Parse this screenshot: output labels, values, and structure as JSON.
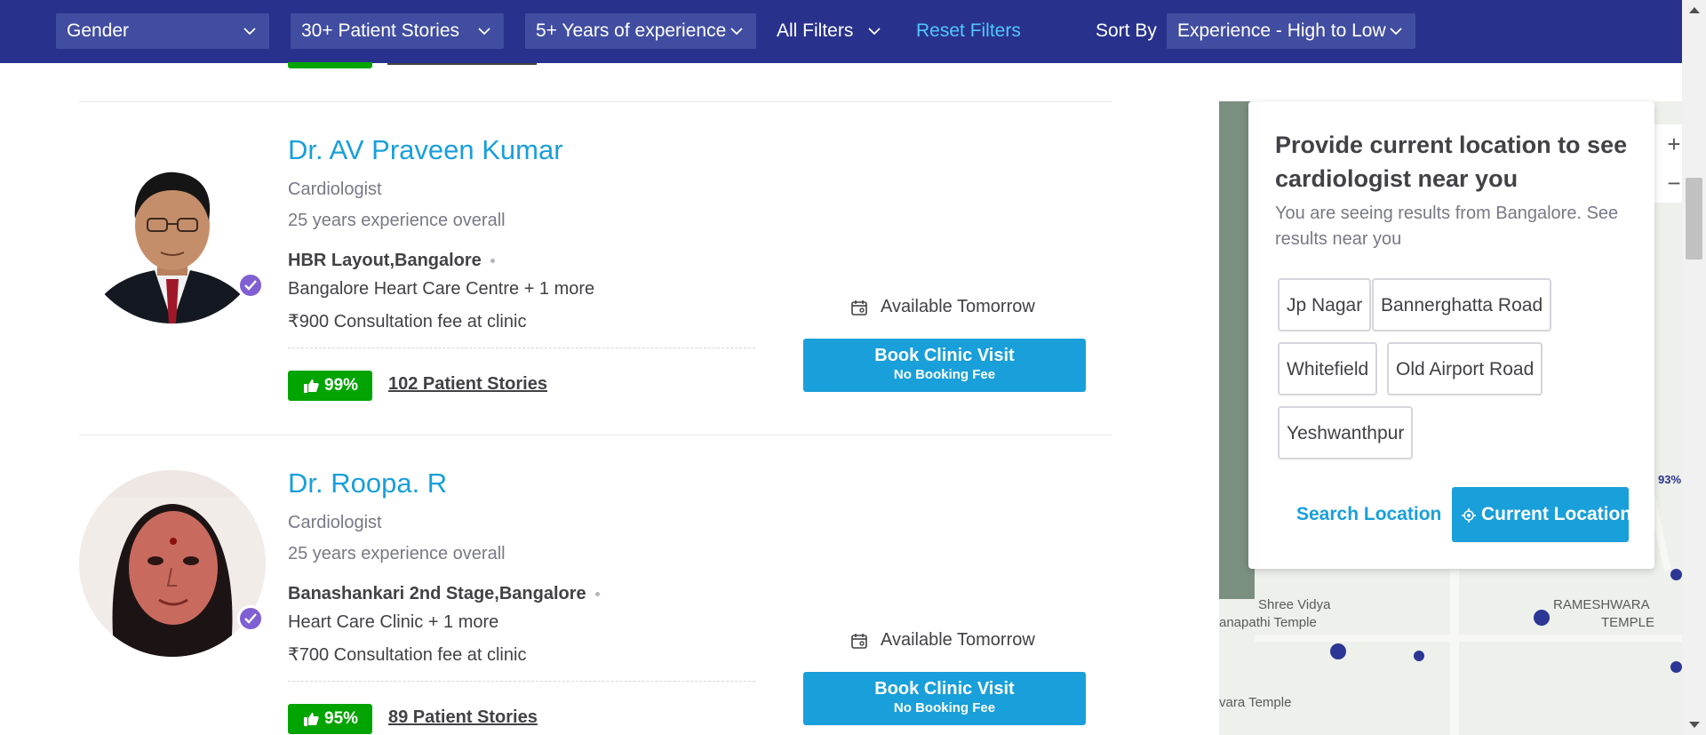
{
  "filters": {
    "gender": "Gender",
    "patient_stories": "30+ Patient Stories",
    "experience": "5+ Years of experience",
    "all_filters": "All Filters",
    "reset": "Reset Filters",
    "sort_by_label": "Sort By",
    "sort_value": "Experience - High to Low"
  },
  "doctors": [
    {
      "name": "Dr. AV Praveen Kumar",
      "specialty": "Cardiologist",
      "experience": "25 years experience overall",
      "locality": "HBR Layout,Bangalore",
      "clinic": "Bangalore Heart Care Centre + 1 more",
      "fee": "₹900 Consultation fee at clinic",
      "rating": "99%",
      "stories": "102 Patient Stories",
      "availability": "Available Tomorrow",
      "book_label": "Book Clinic Visit",
      "book_sub": "No Booking Fee"
    },
    {
      "name": "Dr. Roopa. R",
      "specialty": "Cardiologist",
      "experience": "25 years experience overall",
      "locality": "Banashankari 2nd Stage,Bangalore",
      "clinic": "Heart Care Clinic + 1 more",
      "fee": "₹700 Consultation fee at clinic",
      "rating": "95%",
      "stories": "89 Patient Stories",
      "availability": "Available Tomorrow",
      "book_label": "Book Clinic Visit",
      "book_sub": "No Booking Fee"
    }
  ],
  "location_panel": {
    "title": "Provide current location to see cardiologist near you",
    "subtitle": "You are seeing results from Bangalore. See results near you",
    "chips": [
      "Jp Nagar",
      "Bannerghatta Road",
      "Whitefield",
      "Old Airport Road",
      "Yeshwanthpur"
    ],
    "search_location": "Search Location",
    "current_location": "Current Location"
  },
  "map": {
    "labels": [
      "Shree Vidya",
      "anapathi Temple",
      "RAMESHWARA",
      "TEMPLE",
      "vara Temple",
      "93%"
    ],
    "zoom_in": "+",
    "zoom_out": "−"
  },
  "colors": {
    "header": "#28328c",
    "dropdown": "#414da0",
    "accent": "#199fd9",
    "rating_green": "#01a400",
    "verified": "#7f5fd1"
  },
  "icons": [
    "chevron-down-icon",
    "verified-check-icon",
    "thumbs-up-icon",
    "calendar-icon",
    "location-target-icon"
  ]
}
